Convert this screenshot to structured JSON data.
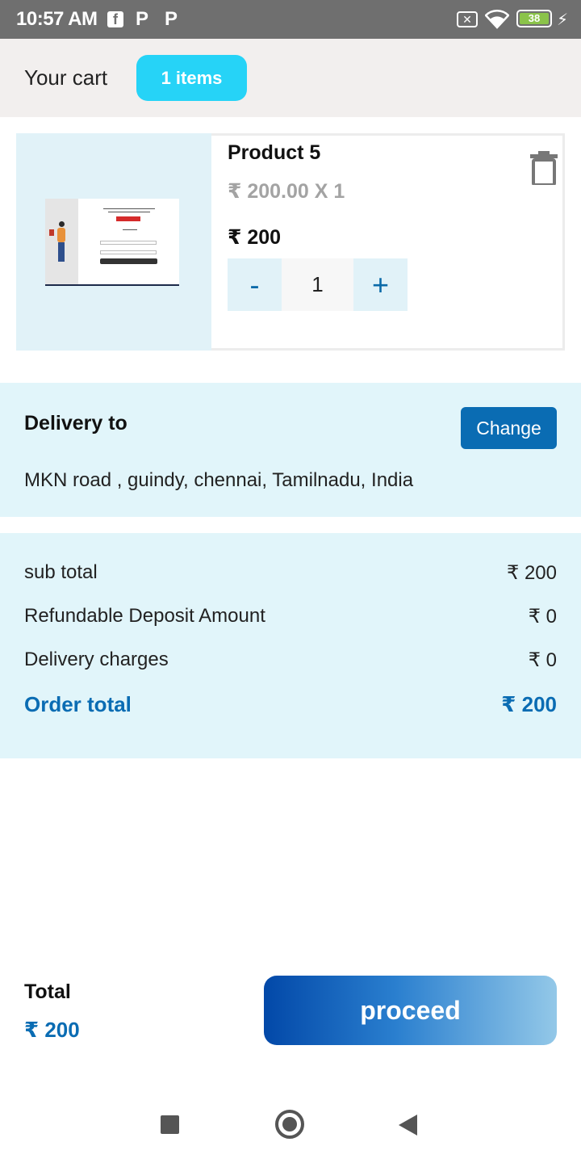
{
  "status_bar": {
    "time": "10:57 AM",
    "battery": "38",
    "icons": [
      "facebook-icon",
      "p-app-icon",
      "p-app-icon",
      "no-sim-icon",
      "wifi-icon",
      "battery-icon",
      "charging-bolt-icon"
    ]
  },
  "header": {
    "title": "Your cart",
    "badge": "1 items",
    "badge_color": "#26d3f7"
  },
  "cart": {
    "items": [
      {
        "name": "Product 5",
        "unit_price_line": "₹ 200.00 X 1",
        "price": "₹ 200",
        "quantity": "1",
        "minus_label": "-",
        "plus_label": "+"
      }
    ]
  },
  "delivery": {
    "label": "Delivery to",
    "change_label": "Change",
    "address": "MKN road , guindy, chennai, Tamilnadu, India"
  },
  "summary": {
    "rows": [
      {
        "label": "sub total",
        "value": "₹ 200"
      },
      {
        "label": "Refundable Deposit Amount",
        "value": "₹ 0"
      },
      {
        "label": "Delivery charges",
        "value": "₹ 0"
      }
    ],
    "order_total_label": "Order total",
    "order_total_value": "₹ 200",
    "accent_color": "#0a6cb3"
  },
  "footer": {
    "total_label": "Total",
    "total_value": "₹ 200",
    "proceed_label": "proceed"
  },
  "nav_bar": {
    "icons": [
      "recents-icon",
      "home-icon",
      "back-icon"
    ]
  }
}
